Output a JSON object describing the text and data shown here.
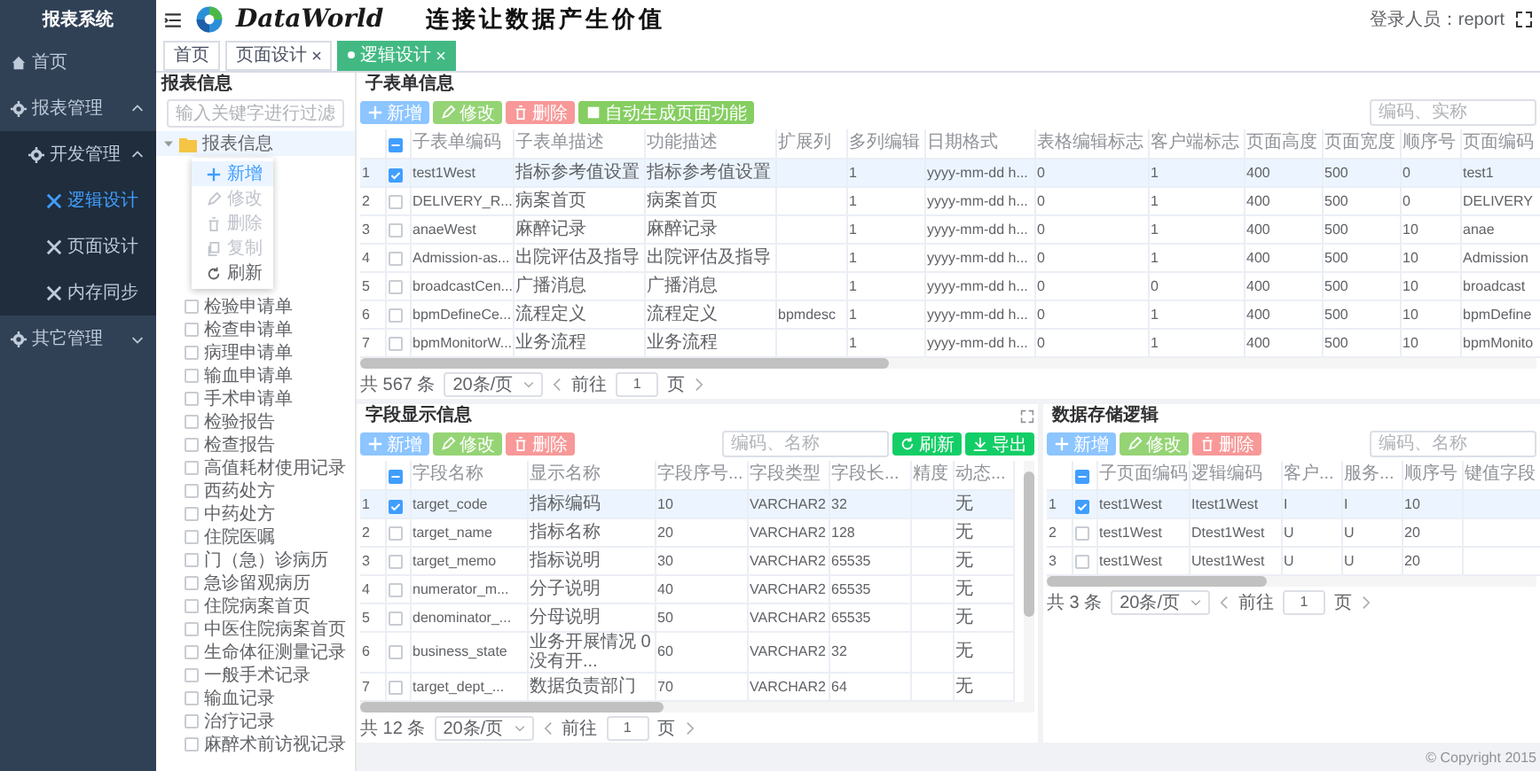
{
  "sidebar": {
    "title": "报表系统",
    "items": [
      {
        "label": "首页",
        "selected": false
      },
      {
        "label": "报表管理",
        "expanded": true,
        "children": [
          {
            "label": "开发管理",
            "expanded": true,
            "children": [
              {
                "label": "逻辑设计",
                "selected": true
              },
              {
                "label": "页面设计",
                "selected": false
              },
              {
                "label": "内存同步",
                "selected": false
              }
            ]
          }
        ]
      },
      {
        "label": "其它管理",
        "expanded": false
      }
    ]
  },
  "header": {
    "logo_text": "DataWorld",
    "slogan": "连接让数据产生价值",
    "user": "登录人员：report"
  },
  "tabs": [
    {
      "label": "首页",
      "selected": false,
      "closable": false
    },
    {
      "label": "页面设计",
      "selected": false,
      "closable": true
    },
    {
      "label": "逻辑设计",
      "selected": true,
      "closable": true
    }
  ],
  "tree_panel": {
    "title": "报表信息",
    "filter": {
      "placeholder": "输入关键字进行过滤"
    },
    "root": {
      "label": "报表信息",
      "expanded": true
    },
    "context_menu": [
      {
        "label": "新增",
        "kind": "add",
        "disabled": false
      },
      {
        "label": "修改",
        "kind": "edit",
        "disabled": true
      },
      {
        "label": "删除",
        "kind": "delete",
        "disabled": true
      },
      {
        "label": "复制",
        "kind": "copy",
        "disabled": true
      },
      {
        "label": "刷新",
        "kind": "refresh",
        "disabled": false
      }
    ],
    "items": [
      {
        "label": "检验申请单",
        "checked": false
      },
      {
        "label": "检查申请单",
        "checked": false
      },
      {
        "label": "病理申请单",
        "checked": false
      },
      {
        "label": "输血申请单",
        "checked": false
      },
      {
        "label": "手术申请单",
        "checked": false
      },
      {
        "label": "检验报告",
        "checked": false
      },
      {
        "label": "检查报告",
        "checked": false
      },
      {
        "label": "高值耗材使用记录",
        "checked": false
      },
      {
        "label": "西药处方",
        "checked": false
      },
      {
        "label": "中药处方",
        "checked": false
      },
      {
        "label": "住院医嘱",
        "checked": false
      },
      {
        "label": "门（急）诊病历",
        "checked": false
      },
      {
        "label": "急诊留观病历",
        "checked": false
      },
      {
        "label": "住院病案首页",
        "checked": false
      },
      {
        "label": "中医住院病案首页",
        "checked": false
      },
      {
        "label": "生命体征测量记录",
        "checked": false
      },
      {
        "label": "一般手术记录",
        "checked": false
      },
      {
        "label": "输血记录",
        "checked": false
      },
      {
        "label": "治疗记录",
        "checked": false
      },
      {
        "label": "麻醉术前访视记录",
        "checked": false
      }
    ]
  },
  "subform_panel": {
    "title": "子表单信息",
    "buttons": [
      {
        "label": "新增",
        "kind": "add"
      },
      {
        "label": "修改",
        "kind": "edit"
      },
      {
        "label": "删除",
        "kind": "delete"
      },
      {
        "label": "自动生成页面功能",
        "kind": "generate"
      }
    ],
    "search": {
      "placeholder": "编码、实称"
    },
    "select_all_partial": true,
    "columns": [
      "子表单编码",
      "子表单描述",
      "功能描述",
      "扩展列",
      "多列编辑",
      "日期格式",
      "表格编辑标志",
      "客户端标志",
      "页面高度",
      "页面宽度",
      "顺序号",
      "页面编码"
    ],
    "rows": [
      {
        "no": "1",
        "selected": true,
        "checked": true,
        "cells": [
          "test1West",
          "指标参考值设置",
          "指标参考值设置",
          null,
          "1",
          "yyyy-mm-dd h...",
          "0",
          "1",
          "400",
          "500",
          "0",
          "test1"
        ]
      },
      {
        "no": "2",
        "selected": false,
        "checked": false,
        "cells": [
          "DELIVERY_R...",
          "病案首页",
          "病案首页",
          null,
          "1",
          "yyyy-mm-dd h...",
          "0",
          "1",
          "400",
          "500",
          "0",
          "DELIVERY"
        ]
      },
      {
        "no": "3",
        "selected": false,
        "checked": false,
        "cells": [
          "anaeWest",
          "麻醉记录",
          "麻醉记录",
          null,
          "1",
          "yyyy-mm-dd h...",
          "0",
          "1",
          "400",
          "500",
          "10",
          "anae"
        ]
      },
      {
        "no": "4",
        "selected": false,
        "checked": false,
        "cells": [
          "Admission-as...",
          "出院评估及指导",
          "出院评估及指导",
          null,
          "1",
          "yyyy-mm-dd h...",
          "0",
          "1",
          "400",
          "500",
          "10",
          "Admission"
        ]
      },
      {
        "no": "5",
        "selected": false,
        "checked": false,
        "cells": [
          "broadcastCen...",
          "广播消息",
          "广播消息",
          null,
          "1",
          "yyyy-mm-dd h...",
          "0",
          "0",
          "400",
          "500",
          "10",
          "broadcast"
        ]
      },
      {
        "no": "6",
        "selected": false,
        "checked": false,
        "cells": [
          "bpmDefineCe...",
          "流程定义",
          "流程定义",
          "bpmdesc",
          "1",
          "yyyy-mm-dd h...",
          "0",
          "1",
          "400",
          "500",
          "10",
          "bpmDefine"
        ]
      },
      {
        "no": "7",
        "selected": false,
        "checked": false,
        "cells": [
          "bpmMonitorW...",
          "业务流程",
          "业务流程",
          null,
          "1",
          "yyyy-mm-dd h...",
          "0",
          "1",
          "400",
          "500",
          "10",
          "bpmMonito"
        ]
      }
    ],
    "pager": {
      "total": "共 567 条",
      "page_size": "20条/页",
      "goto": "前往",
      "page": "1",
      "page_unit": "页"
    }
  },
  "field_panel": {
    "title": "字段显示信息",
    "buttons": [
      {
        "label": "新增",
        "kind": "add"
      },
      {
        "label": "修改",
        "kind": "edit"
      },
      {
        "label": "删除",
        "kind": "delete"
      },
      {
        "label": "刷新",
        "kind": "refresh"
      },
      {
        "label": "导出",
        "kind": "export"
      }
    ],
    "search": {
      "placeholder": "编码、名称"
    },
    "select_all_partial": true,
    "columns": [
      "字段名称",
      "显示名称",
      "字段序号...",
      "字段类型",
      "字段长...",
      "精度",
      "动态..."
    ],
    "rows": [
      {
        "no": "1",
        "selected": true,
        "checked": true,
        "cells": [
          "target_code",
          "指标编码",
          "10",
          "VARCHAR2",
          "32",
          null,
          "无"
        ]
      },
      {
        "no": "2",
        "selected": false,
        "checked": false,
        "cells": [
          "target_name",
          "指标名称",
          "20",
          "VARCHAR2",
          "128",
          null,
          "无"
        ]
      },
      {
        "no": "3",
        "selected": false,
        "checked": false,
        "cells": [
          "target_memo",
          "指标说明",
          "30",
          "VARCHAR2",
          "65535",
          null,
          "无"
        ]
      },
      {
        "no": "4",
        "selected": false,
        "checked": false,
        "cells": [
          "numerator_m...",
          "分子说明",
          "40",
          "VARCHAR2",
          "65535",
          null,
          "无"
        ]
      },
      {
        "no": "5",
        "selected": false,
        "checked": false,
        "cells": [
          "denominator_...",
          "分母说明",
          "50",
          "VARCHAR2",
          "65535",
          null,
          "无"
        ]
      },
      {
        "no": "6",
        "selected": false,
        "checked": false,
        "cells": [
          "business_state",
          "业务开展情况 0没有开...",
          "60",
          "VARCHAR2",
          "32",
          null,
          "无"
        ]
      },
      {
        "no": "7",
        "selected": false,
        "checked": false,
        "cells": [
          "target_dept_...",
          "数据负责部门",
          "70",
          "VARCHAR2",
          "64",
          null,
          "无"
        ]
      }
    ],
    "pager": {
      "total": "共 12 条",
      "page_size": "20条/页",
      "goto": "前往",
      "page": "1",
      "page_unit": "页"
    }
  },
  "storage_panel": {
    "title": "数据存储逻辑",
    "buttons": [
      {
        "label": "新增",
        "kind": "add"
      },
      {
        "label": "修改",
        "kind": "edit"
      },
      {
        "label": "删除",
        "kind": "delete"
      }
    ],
    "search": {
      "placeholder": "编码、名称"
    },
    "select_all_partial": true,
    "columns": [
      "子页面编码",
      "逻辑编码",
      "客户...",
      "服务...",
      "顺序号",
      "键值字段"
    ],
    "rows": [
      {
        "no": "1",
        "selected": true,
        "checked": true,
        "cells": [
          "test1West",
          "Itest1West",
          "I",
          "I",
          "10",
          null
        ]
      },
      {
        "no": "2",
        "selected": false,
        "checked": false,
        "cells": [
          "test1West",
          "Dtest1West",
          "U",
          "U",
          "20",
          null
        ]
      },
      {
        "no": "3",
        "selected": false,
        "checked": false,
        "cells": [
          "test1West",
          "Utest1West",
          "U",
          "U",
          "20",
          null
        ]
      }
    ],
    "pager": {
      "total": "共 3 条",
      "page_size": "20条/页",
      "goto": "前往",
      "page": "1",
      "page_unit": "页"
    }
  },
  "footer": {
    "copyright": "© Copyright 2015"
  }
}
